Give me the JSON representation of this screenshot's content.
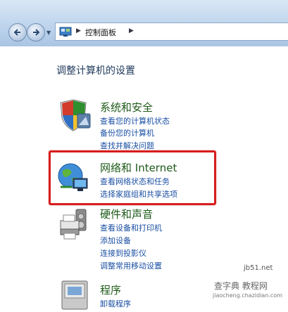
{
  "address_bar": {
    "breadcrumb": "控制面板"
  },
  "page": {
    "heading": "调整计算机的设置"
  },
  "categories": [
    {
      "title": "系统和安全",
      "icon": "shield-icon",
      "links": [
        "查看您的计算机状态",
        "备份您的计算机",
        "查找并解决问题"
      ]
    },
    {
      "title": "网络和 Internet",
      "icon": "network-globe-icon",
      "links": [
        "查看网络状态和任务",
        "选择家庭组和共享选项"
      ]
    },
    {
      "title": "硬件和声音",
      "icon": "printer-icon",
      "links": [
        "查看设备和打印机",
        "添加设备",
        "连接到投影仪",
        "调整常用移动设置"
      ]
    },
    {
      "title": "程序",
      "icon": "programs-icon",
      "links": [
        "卸载程序"
      ]
    }
  ],
  "watermark": {
    "line1": "jb51.net",
    "line2": "查字典 教程网",
    "line3": "jiaocheng.chazidian.com"
  },
  "colors": {
    "title_green": "#1e5a18",
    "link_blue": "#1a4fa3",
    "highlight_red": "#d61e1e"
  }
}
